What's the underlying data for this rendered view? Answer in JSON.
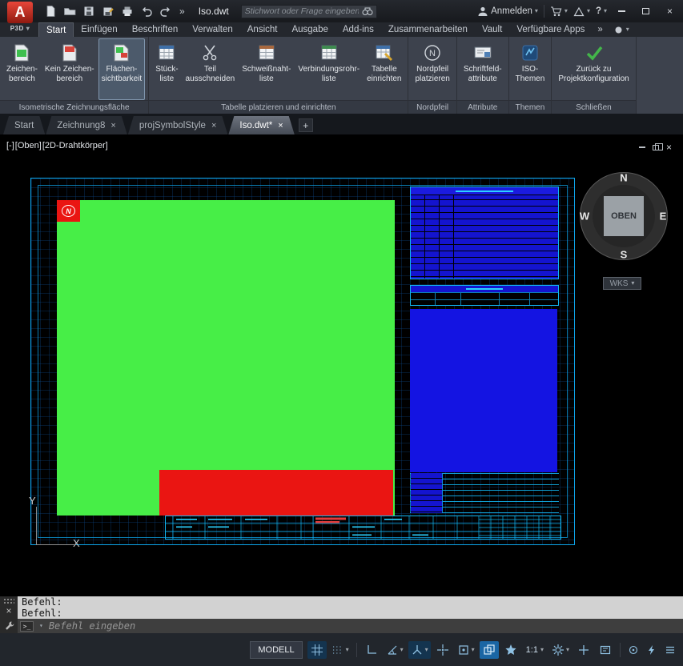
{
  "titlebar": {
    "app_short": "P3D",
    "doc_title": "Iso.dwt",
    "search_placeholder": "Stichwort oder Frage eingeben",
    "signin": "Anmelden",
    "help_label": "?"
  },
  "glyphs": {
    "close": "×",
    "caret": "▾",
    "more": "»",
    "plus": "+"
  },
  "ribbon_tabs": {
    "items": [
      "Start",
      "Einfügen",
      "Beschriften",
      "Verwalten",
      "Ansicht",
      "Ausgabe",
      "Add-ins",
      "Zusammenarbeiten",
      "Vault",
      "Verfügbare Apps"
    ],
    "active": "Start"
  },
  "ribbon": {
    "panels": [
      {
        "title": "Isometrische Zeichnungsfläche",
        "buttons": [
          {
            "label": "Zeichen-\nbereich"
          },
          {
            "label": "Kein Zeichen-\nbereich"
          },
          {
            "label": "Flächen-\nsichtbarkeit"
          }
        ]
      },
      {
        "title": "Tabelle platzieren und einrichten",
        "buttons": [
          {
            "label": "Stück-\nliste"
          },
          {
            "label": "Teil\nausschneiden"
          },
          {
            "label": "Schweißnaht-\nliste"
          },
          {
            "label": "Verbindungsrohr-\nliste"
          },
          {
            "label": "Tabelle\neinrichten"
          }
        ]
      },
      {
        "title": "Nordpfeil",
        "buttons": [
          {
            "label": "Nordpfeil\nplatzieren"
          }
        ]
      },
      {
        "title": "Attribute",
        "buttons": [
          {
            "label": "Schriftfeld-\nattribute"
          }
        ]
      },
      {
        "title": "Themen",
        "buttons": [
          {
            "label": "ISO-\nThemen"
          }
        ]
      },
      {
        "title": "Schließen",
        "buttons": [
          {
            "label": "Zurück zu\nProjektkonfiguration"
          }
        ]
      }
    ]
  },
  "file_tabs": {
    "tabs": [
      {
        "label": "Start",
        "closable": false,
        "active": false
      },
      {
        "label": "Zeichnung8",
        "closable": true,
        "active": false
      },
      {
        "label": "projSymbolStyle",
        "closable": true,
        "active": false
      },
      {
        "label": "Iso.dwt*",
        "closable": true,
        "active": true
      }
    ]
  },
  "viewport": {
    "controls": {
      "minus": "[-]",
      "view": "[Oben]",
      "visual": "[2D-Drahtkörper]"
    },
    "viewcube": {
      "north": "N",
      "west": "W",
      "east": "E",
      "south": "S",
      "top": "OBEN"
    },
    "ucs_button": "WKS",
    "axis_y": "Y",
    "axis_x": "X",
    "north_symbol": "N"
  },
  "command": {
    "history": [
      "Befehl:",
      "Befehl:"
    ],
    "placeholder": "Befehl eingeben"
  },
  "statusbar": {
    "model": "MODELL",
    "scale": "1:1"
  },
  "colors": {
    "cyan": "#12b7f2",
    "green": "#47ee47",
    "red": "#ea1512",
    "blue": "#1414e2",
    "ribbon_bg": "#3d424d",
    "accent": "#1a66a4"
  }
}
